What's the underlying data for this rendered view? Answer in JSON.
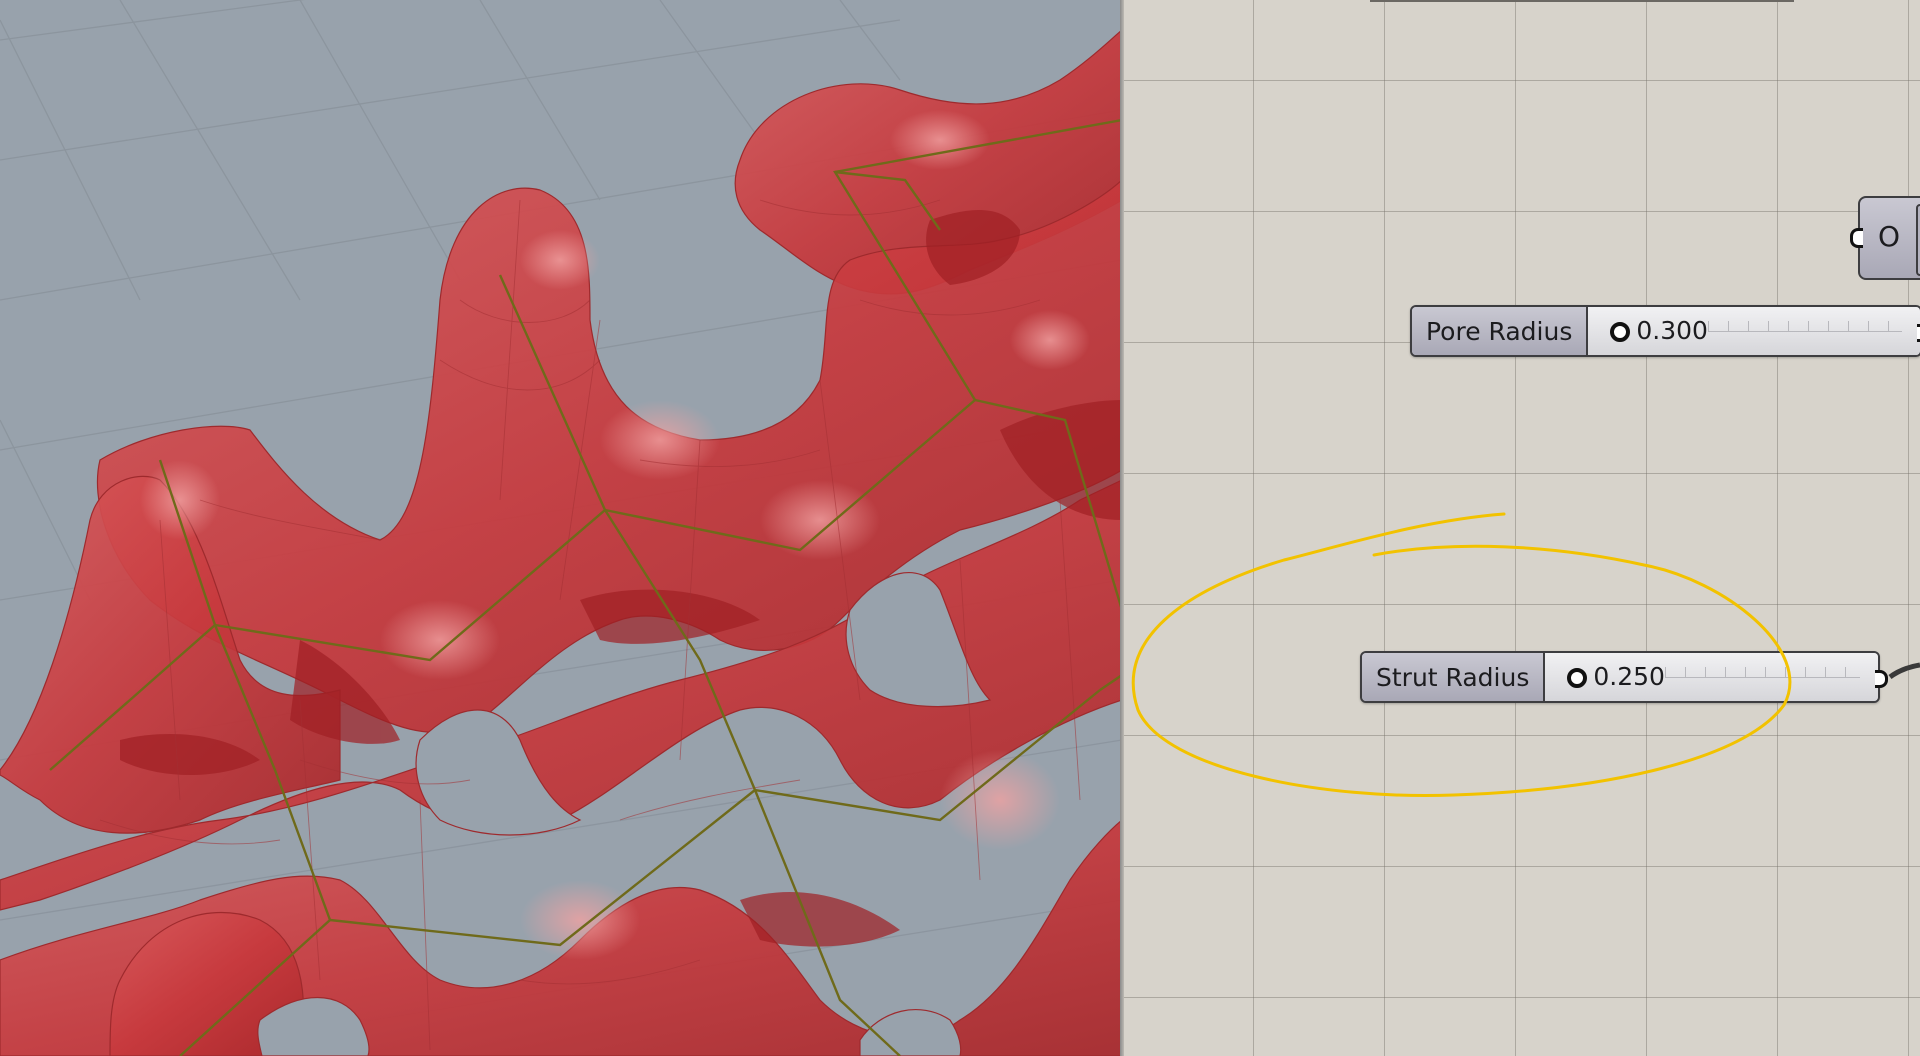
{
  "gh_canvas": {
    "pore_slider": {
      "label": "Pore Radius",
      "value": "0.300"
    },
    "strut_slider": {
      "label": "Strut Radius",
      "value": "0.250"
    },
    "output_node": {
      "glyph": "O"
    }
  },
  "colors": {
    "viewport_background": "#98a2ac",
    "mesh_fill": "#c8383c",
    "skeleton_line": "#6f6a1a",
    "canvas_background": "#d7d3cb",
    "annotation": "#f2c200"
  }
}
